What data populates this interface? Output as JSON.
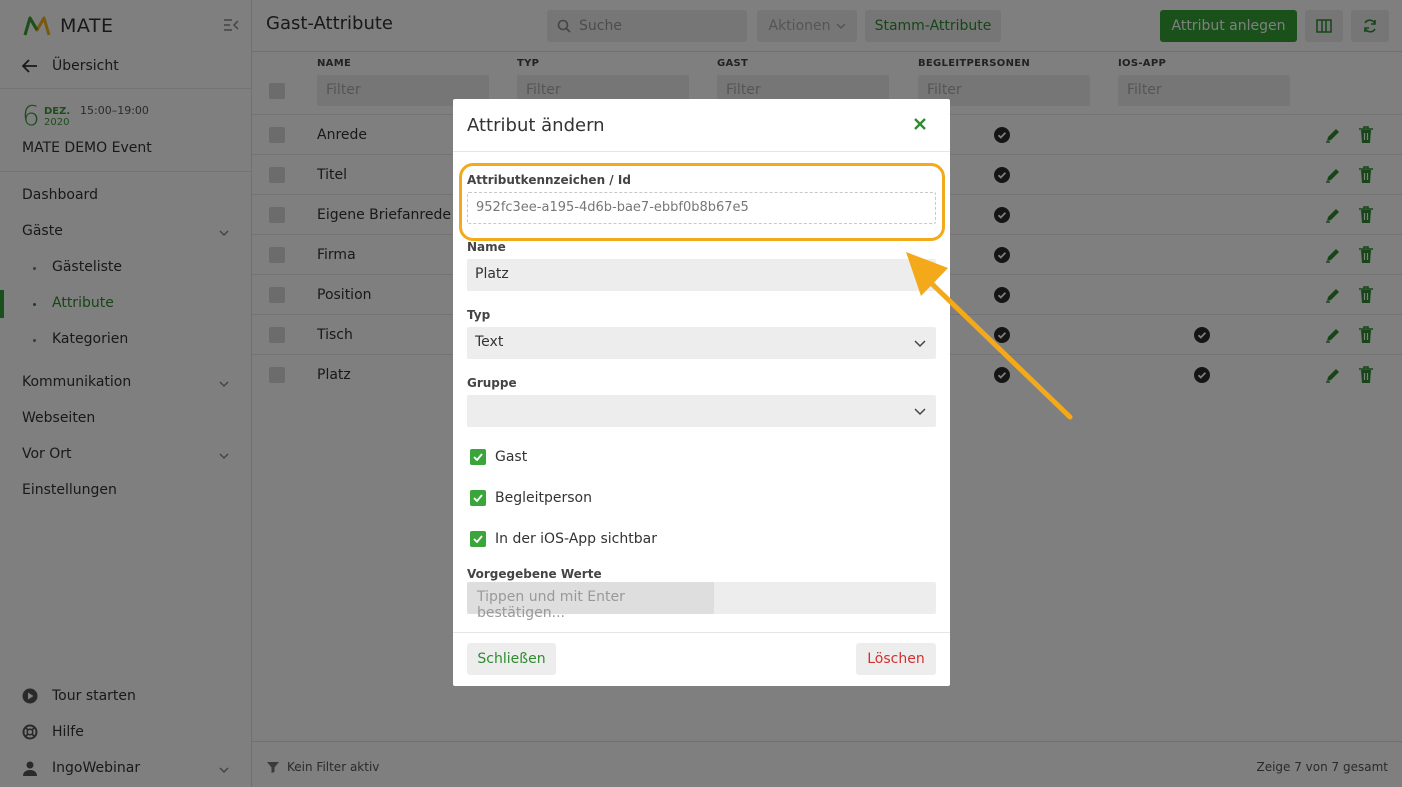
{
  "sidebar": {
    "brand": "MATE",
    "back_label": "Übersicht",
    "event": {
      "day": "6",
      "month": "DEZ.",
      "year": "2020",
      "time": "15:00–19:00",
      "name": "MATE DEMO Event"
    },
    "nav": {
      "dashboard": "Dashboard",
      "gaeste": "Gäste",
      "gaesteliste": "Gästeliste",
      "attribute": "Attribute",
      "kategorien": "Kategorien",
      "kommunikation": "Kommunikation",
      "webseiten": "Webseiten",
      "vor_ort": "Vor Ort",
      "einstellungen": "Einstellungen"
    },
    "bottom": {
      "tour": "Tour starten",
      "hilfe": "Hilfe",
      "user": "IngoWebinar"
    }
  },
  "header": {
    "title": "Gast-Attribute",
    "search_placeholder": "Suche",
    "actions_label": "Aktionen",
    "stamm_label": "Stamm-Attribute",
    "create_label": "Attribut anlegen"
  },
  "table": {
    "columns": [
      "NAME",
      "TYP",
      "GAST",
      "BEGLEITPERSONEN",
      "IOS-APP"
    ],
    "filter_placeholder": "Filter",
    "rows": [
      {
        "name": "Anrede",
        "begleit": true,
        "ios": false
      },
      {
        "name": "Titel",
        "begleit": true,
        "ios": false
      },
      {
        "name": "Eigene Briefanrede",
        "begleit": true,
        "ios": false
      },
      {
        "name": "Firma",
        "begleit": true,
        "ios": false
      },
      {
        "name": "Position",
        "begleit": true,
        "ios": false
      },
      {
        "name": "Tisch",
        "begleit": true,
        "ios": true
      },
      {
        "name": "Platz",
        "begleit": true,
        "ios": true
      }
    ]
  },
  "footer": {
    "filter_status": "Kein Filter aktiv",
    "count": "Zeige 7 von 7 gesamt"
  },
  "modal": {
    "title": "Attribut ändern",
    "id_label": "Attributkennzeichen / Id",
    "id_value": "952fc3ee-a195-4d6b-bae7-ebbf0b8b67e5",
    "name_label": "Name",
    "name_value": "Platz",
    "typ_label": "Typ",
    "typ_value": "Text",
    "gruppe_label": "Gruppe",
    "gruppe_value": "",
    "checkboxes": [
      "Gast",
      "Begleitperson",
      "In der iOS-App sichtbar"
    ],
    "values_label": "Vorgegebene Werte",
    "values_placeholder": "Tippen und mit Enter bestätigen...",
    "close_label": "Schließen",
    "delete_label": "Löschen"
  },
  "colors": {
    "brand": "#34a236",
    "highlight": "#f4a91a",
    "danger": "#d32f2f"
  }
}
